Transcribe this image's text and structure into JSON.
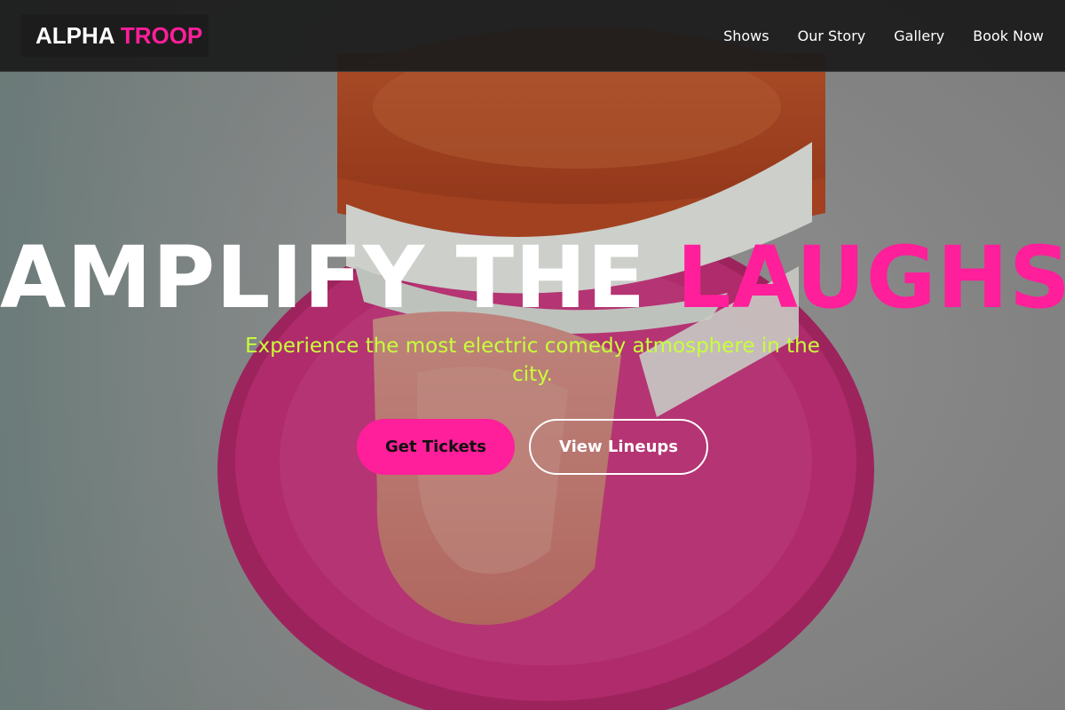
{
  "nav": {
    "logo_word1": "ALPHA",
    "logo_word2": "TROOP",
    "links": [
      "Shows",
      "Our Story",
      "Gallery",
      "Book Now"
    ]
  },
  "hero": {
    "headline_part1": "AMPLIFY THE",
    "headline_part2": "LAUGHS",
    "subtitle": "Experience the most electric comedy atmosphere in the city.",
    "primary_button": "Get Tickets",
    "secondary_button": "View Lineups"
  },
  "colors": {
    "accent": "#ff1f9a",
    "subtitle": "#c8ff3a",
    "navbar": "#1c1c1c"
  }
}
